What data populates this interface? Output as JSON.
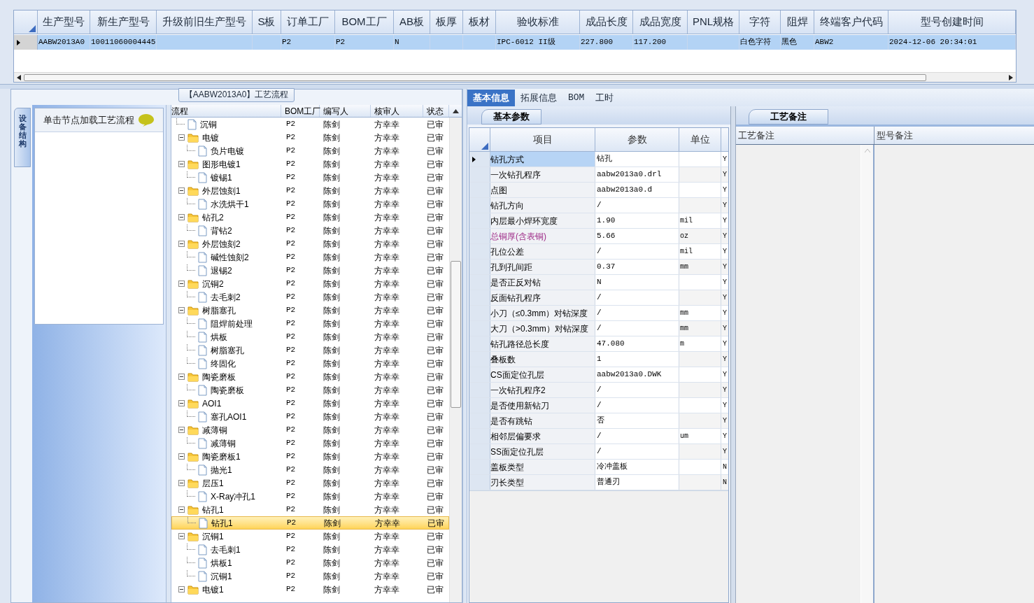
{
  "top_grid": {
    "selected": true,
    "columns": [
      {
        "heading": "生产型号",
        "value": "AABW2013A0"
      },
      {
        "heading": "新生产型号",
        "value": "10011060004445"
      },
      {
        "heading": "升级前旧生产型号"
      },
      {
        "heading": "S板"
      },
      {
        "heading": "订单工厂",
        "value": "P2"
      },
      {
        "heading": "BOM工厂",
        "value": "P2"
      },
      {
        "heading": "AB板",
        "value": "N"
      },
      {
        "heading": "板厚"
      },
      {
        "heading": "板材"
      },
      {
        "heading": "验收标准",
        "value": "IPC-6012 II级"
      },
      {
        "heading": "成品长度",
        "value": "227.800"
      },
      {
        "heading": "成品宽度",
        "value": "117.200"
      },
      {
        "heading": "PNL规格"
      },
      {
        "heading": "字符",
        "value": "白色字符"
      },
      {
        "heading": "阻焊",
        "value": "黑色"
      },
      {
        "heading": "终端客户代码",
        "value": "ABW2"
      },
      {
        "heading": "型号创建时间",
        "value": "2024-12-06 20:34:01"
      }
    ]
  },
  "flow_panel": {
    "title": "【AABW2013A0】工艺流程",
    "side_tab": "设备结构",
    "hint": "单击节点加载工艺流程",
    "columns": [
      "流程",
      "BOM工厂",
      "编写人",
      "核审人",
      "状态"
    ],
    "tree": [
      {
        "label": "沉铜",
        "kind": "file",
        "selected": false,
        "bom": "P2",
        "writer": "陈剑",
        "reviewer": "方幸幸",
        "status": "已审"
      },
      {
        "label": "电镀",
        "kind": "folder",
        "expanded": true,
        "selected": false,
        "bom": "P2",
        "writer": "陈剑",
        "reviewer": "方幸幸",
        "status": "已审",
        "children": [
          {
            "label": "负片电镀",
            "kind": "file",
            "selected": false,
            "bom": "P2",
            "writer": "陈剑",
            "reviewer": "方幸幸",
            "status": "已审"
          }
        ]
      },
      {
        "label": "图形电镀1",
        "kind": "folder",
        "expanded": true,
        "selected": false,
        "bom": "P2",
        "writer": "陈剑",
        "reviewer": "方幸幸",
        "status": "已审",
        "children": [
          {
            "label": "镀锡1",
            "kind": "file",
            "selected": false,
            "bom": "P2",
            "writer": "陈剑",
            "reviewer": "方幸幸",
            "status": "已审"
          }
        ]
      },
      {
        "label": "外层蚀刻1",
        "kind": "folder",
        "expanded": true,
        "selected": false,
        "bom": "P2",
        "writer": "陈剑",
        "reviewer": "方幸幸",
        "status": "已审",
        "children": [
          {
            "label": "水洗烘干1",
            "kind": "file",
            "selected": false,
            "bom": "P2",
            "writer": "陈剑",
            "reviewer": "方幸幸",
            "status": "已审"
          }
        ]
      },
      {
        "label": "钻孔2",
        "kind": "folder",
        "expanded": true,
        "selected": false,
        "bom": "P2",
        "writer": "陈剑",
        "reviewer": "方幸幸",
        "status": "已审",
        "children": [
          {
            "label": "背钻2",
            "kind": "file",
            "selected": false,
            "bom": "P2",
            "writer": "陈剑",
            "reviewer": "方幸幸",
            "status": "已审"
          }
        ]
      },
      {
        "label": "外层蚀刻2",
        "kind": "folder",
        "expanded": true,
        "selected": false,
        "bom": "P2",
        "writer": "陈剑",
        "reviewer": "方幸幸",
        "status": "已审",
        "children": [
          {
            "label": "碱性蚀刻2",
            "kind": "file",
            "selected": false,
            "bom": "P2",
            "writer": "陈剑",
            "reviewer": "方幸幸",
            "status": "已审"
          },
          {
            "label": "退锡2",
            "kind": "file",
            "selected": false,
            "bom": "P2",
            "writer": "陈剑",
            "reviewer": "方幸幸",
            "status": "已审"
          }
        ]
      },
      {
        "label": "沉铜2",
        "kind": "folder",
        "expanded": true,
        "selected": false,
        "bom": "P2",
        "writer": "陈剑",
        "reviewer": "方幸幸",
        "status": "已审",
        "children": [
          {
            "label": "去毛刺2",
            "kind": "file",
            "selected": false,
            "bom": "P2",
            "writer": "陈剑",
            "reviewer": "方幸幸",
            "status": "已审"
          }
        ]
      },
      {
        "label": "树脂塞孔",
        "kind": "folder",
        "expanded": true,
        "selected": false,
        "bom": "P2",
        "writer": "陈剑",
        "reviewer": "方幸幸",
        "status": "已审",
        "children": [
          {
            "label": "阻焊前处理",
            "kind": "file",
            "selected": false,
            "bom": "P2",
            "writer": "陈剑",
            "reviewer": "方幸幸",
            "status": "已审"
          },
          {
            "label": "烘板",
            "kind": "file",
            "selected": false,
            "bom": "P2",
            "writer": "陈剑",
            "reviewer": "方幸幸",
            "status": "已审"
          },
          {
            "label": "树脂塞孔",
            "kind": "file",
            "selected": false,
            "bom": "P2",
            "writer": "陈剑",
            "reviewer": "方幸幸",
            "status": "已审"
          },
          {
            "label": "终固化",
            "kind": "file",
            "selected": false,
            "bom": "P2",
            "writer": "陈剑",
            "reviewer": "方幸幸",
            "status": "已审"
          }
        ]
      },
      {
        "label": "陶瓷磨板",
        "kind": "folder",
        "expanded": true,
        "selected": false,
        "bom": "P2",
        "writer": "陈剑",
        "reviewer": "方幸幸",
        "status": "已审",
        "children": [
          {
            "label": "陶瓷磨板",
            "kind": "file",
            "selected": false,
            "bom": "P2",
            "writer": "陈剑",
            "reviewer": "方幸幸",
            "status": "已审"
          }
        ]
      },
      {
        "label": "AOI1",
        "kind": "folder",
        "expanded": true,
        "selected": false,
        "bom": "P2",
        "writer": "陈剑",
        "reviewer": "方幸幸",
        "status": "已审",
        "children": [
          {
            "label": "塞孔AOI1",
            "kind": "file",
            "selected": false,
            "bom": "P2",
            "writer": "陈剑",
            "reviewer": "方幸幸",
            "status": "已审"
          }
        ]
      },
      {
        "label": "减薄铜",
        "kind": "folder",
        "expanded": true,
        "selected": false,
        "bom": "P2",
        "writer": "陈剑",
        "reviewer": "方幸幸",
        "status": "已审",
        "children": [
          {
            "label": "减薄铜",
            "kind": "file",
            "selected": false,
            "bom": "P2",
            "writer": "陈剑",
            "reviewer": "方幸幸",
            "status": "已审"
          }
        ]
      },
      {
        "label": "陶瓷磨板1",
        "kind": "folder",
        "expanded": true,
        "selected": false,
        "bom": "P2",
        "writer": "陈剑",
        "reviewer": "方幸幸",
        "status": "已审",
        "children": [
          {
            "label": "抛光1",
            "kind": "file",
            "selected": false,
            "bom": "P2",
            "writer": "陈剑",
            "reviewer": "方幸幸",
            "status": "已审"
          }
        ]
      },
      {
        "label": "层压1",
        "kind": "folder",
        "expanded": true,
        "selected": false,
        "bom": "P2",
        "writer": "陈剑",
        "reviewer": "方幸幸",
        "status": "已审",
        "children": [
          {
            "label": "X-Ray冲孔1",
            "kind": "file",
            "selected": false,
            "bom": "P2",
            "writer": "陈剑",
            "reviewer": "方幸幸",
            "status": "已审"
          }
        ]
      },
      {
        "label": "钻孔1",
        "kind": "folder",
        "expanded": true,
        "selected": false,
        "bom": "P2",
        "writer": "陈剑",
        "reviewer": "方幸幸",
        "status": "已审",
        "children": [
          {
            "label": "钻孔1",
            "kind": "file",
            "selected": true,
            "bom": "P2",
            "writer": "陈剑",
            "reviewer": "方幸幸",
            "status": "已审"
          }
        ]
      },
      {
        "label": "沉铜1",
        "kind": "folder",
        "expanded": true,
        "selected": false,
        "bom": "P2",
        "writer": "陈剑",
        "reviewer": "方幸幸",
        "status": "已审",
        "children": [
          {
            "label": "去毛刺1",
            "kind": "file",
            "selected": false,
            "bom": "P2",
            "writer": "陈剑",
            "reviewer": "方幸幸",
            "status": "已审"
          },
          {
            "label": "烘板1",
            "kind": "file",
            "selected": false,
            "bom": "P2",
            "writer": "陈剑",
            "reviewer": "方幸幸",
            "status": "已审"
          },
          {
            "label": "沉铜1",
            "kind": "file",
            "selected": false,
            "bom": "P2",
            "writer": "陈剑",
            "reviewer": "方幸幸",
            "status": "已审"
          }
        ]
      },
      {
        "label": "电镀1",
        "kind": "folder",
        "expanded": true,
        "selected": false,
        "bom": "P2",
        "writer": "陈剑",
        "reviewer": "方幸幸",
        "status": "已审"
      }
    ]
  },
  "detail": {
    "tabs": [
      {
        "label": "基本信息",
        "selected": true
      },
      {
        "label": "拓展信息",
        "selected": false
      },
      {
        "label": "BOM",
        "selected": false
      },
      {
        "label": "工时",
        "selected": false
      }
    ],
    "sub_tab": "基本参数",
    "columns": [
      "项目",
      "参数",
      "单位"
    ],
    "rows": [
      {
        "item": "钻孔方式",
        "value": "钻孔",
        "flag": "Y",
        "emphasis": false,
        "selected": true
      },
      {
        "item": "一次钻孔程序",
        "value": "aabw2013a0.drl",
        "flag": "Y",
        "emphasis": false,
        "selected": false
      },
      {
        "item": "点图",
        "value": "aabw2013a0.d",
        "flag": "Y",
        "emphasis": false,
        "selected": false
      },
      {
        "item": "钻孔方向",
        "value": "/",
        "flag": "Y",
        "emphasis": false,
        "selected": false
      },
      {
        "item": "内层最小焊环宽度",
        "value": "1.90",
        "unit": "mil",
        "flag": "Y",
        "emphasis": false,
        "selected": false
      },
      {
        "item": "总铜厚(含表铜)",
        "value": "5.66",
        "unit": "oz",
        "flag": "Y",
        "emphasis": true,
        "selected": false
      },
      {
        "item": "孔位公差",
        "value": "/",
        "unit": "mil",
        "flag": "Y",
        "emphasis": false,
        "selected": false
      },
      {
        "item": "孔到孔间距",
        "value": "0.37",
        "unit": "mm",
        "flag": "Y",
        "emphasis": false,
        "selected": false
      },
      {
        "item": "是否正反对钻",
        "value": "N",
        "flag": "Y",
        "emphasis": false,
        "selected": false
      },
      {
        "item": "反面钻孔程序",
        "value": "/",
        "flag": "Y",
        "emphasis": false,
        "selected": false
      },
      {
        "item": "小刀（≤0.3mm）对钻深度",
        "value": "/",
        "unit": "mm",
        "flag": "Y",
        "emphasis": false,
        "selected": false
      },
      {
        "item": "大刀（>0.3mm）对钻深度",
        "value": "/",
        "unit": "mm",
        "flag": "Y",
        "emphasis": false,
        "selected": false
      },
      {
        "item": "钻孔路径总长度",
        "value": "47.080",
        "unit": "m",
        "flag": "Y",
        "emphasis": false,
        "selected": false
      },
      {
        "item": "叠板数",
        "value": "1",
        "flag": "Y",
        "emphasis": false,
        "selected": false
      },
      {
        "item": "CS面定位孔层",
        "value": "aabw2013a0.DWK",
        "flag": "Y",
        "emphasis": false,
        "selected": false
      },
      {
        "item": "一次钻孔程序2",
        "value": "/",
        "flag": "Y",
        "emphasis": false,
        "selected": false
      },
      {
        "item": "是否使用新钻刀",
        "value": "/",
        "flag": "Y",
        "emphasis": false,
        "selected": false
      },
      {
        "item": "是否有跳钻",
        "value": "否",
        "flag": "Y",
        "emphasis": false,
        "selected": false
      },
      {
        "item": "相邻层偏要求",
        "value": "/",
        "unit": "um",
        "flag": "Y",
        "emphasis": false,
        "selected": false
      },
      {
        "item": "SS面定位孔层",
        "value": "/",
        "flag": "Y",
        "emphasis": false,
        "selected": false
      },
      {
        "item": "盖板类型",
        "value": "冷冲盖板",
        "flag": "N",
        "emphasis": false,
        "selected": false
      },
      {
        "item": "刃长类型",
        "value": "普通刃",
        "flag": "N",
        "emphasis": false,
        "selected": false
      }
    ]
  },
  "notes": {
    "tab": "工艺备注",
    "columns": [
      "工艺备注",
      "型号备注"
    ]
  }
}
